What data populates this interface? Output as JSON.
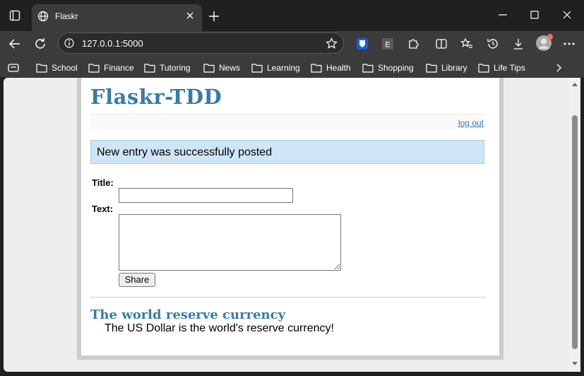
{
  "browser": {
    "tab_title": "Flaskr",
    "url": "127.0.0.1:5000",
    "bookmarks": [
      "School",
      "Finance",
      "Tutoring",
      "News",
      "Learning",
      "Health",
      "Shopping",
      "Library",
      "Life Tips"
    ]
  },
  "page": {
    "brand": "Flaskr-TDD",
    "logout_label": "log out",
    "flash_message": "New entry was successfully posted",
    "form": {
      "title_label": "Title:",
      "text_label": "Text:",
      "title_value": "",
      "text_value": "",
      "share_label": "Share"
    },
    "entries": [
      {
        "title": "The world reserve currency",
        "text": "The US Dollar is the world's reserve currency!"
      }
    ]
  },
  "colors": {
    "accent": "#377ba8",
    "flash_bg": "#cee5f5",
    "browser_chrome": "#3b3b3b"
  }
}
